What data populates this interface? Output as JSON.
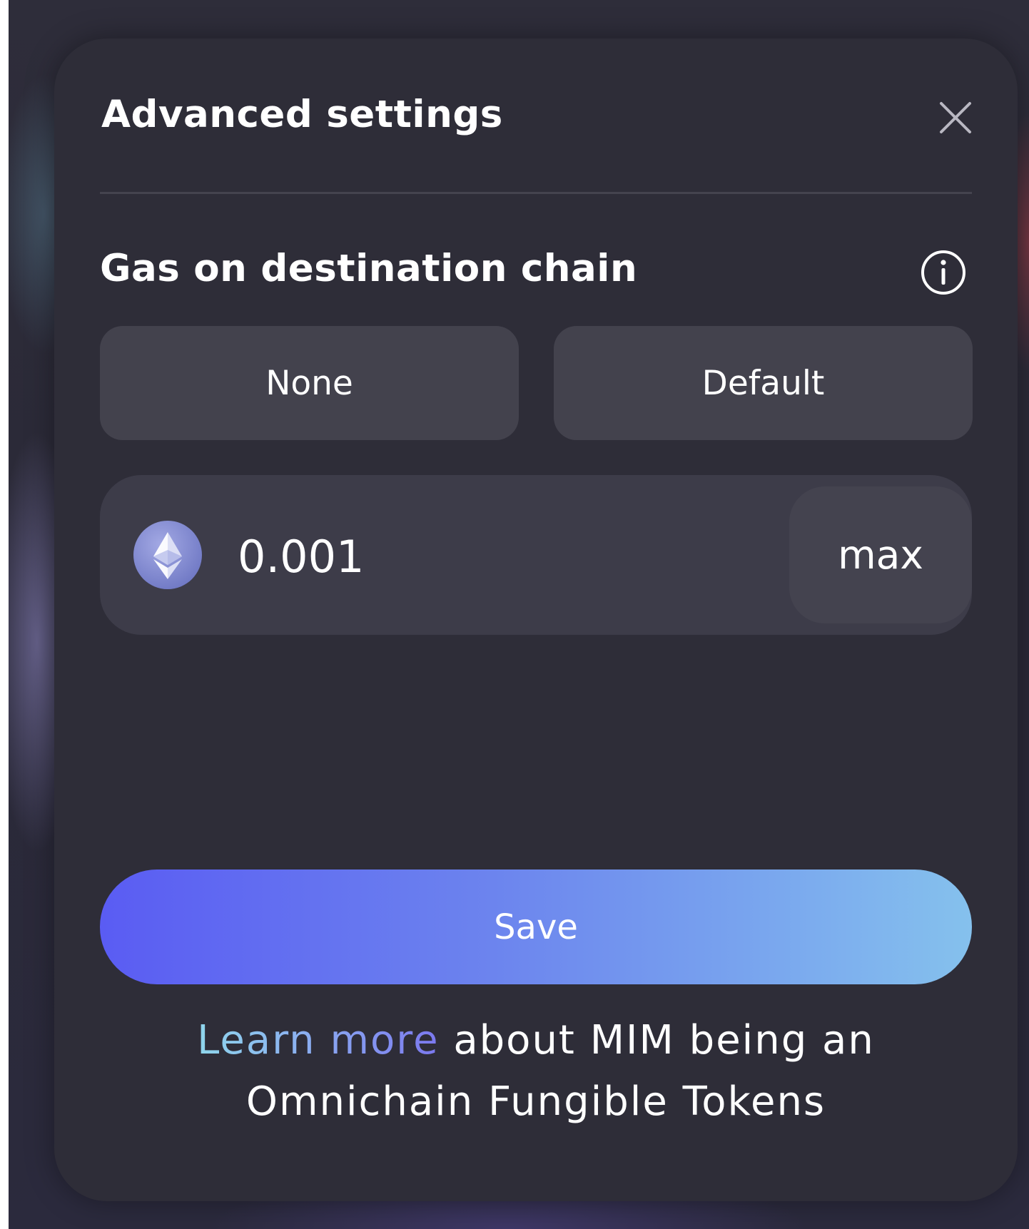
{
  "modal": {
    "title": "Advanced settings",
    "close_icon": "close-icon"
  },
  "gas": {
    "section_title": "Gas on destination chain",
    "info_icon": "info-icon",
    "options": {
      "none_label": "None",
      "default_label": "Default"
    },
    "amount": {
      "token_icon": "ethereum-icon",
      "value": "0.001",
      "max_label": "max"
    }
  },
  "actions": {
    "save_label": "Save"
  },
  "footnote": {
    "link_text": "Learn more",
    "line1_rest": " about MIM being an",
    "line2": "Omnichain Fungible Tokens"
  },
  "colors": {
    "modal_background": "#2e2d38",
    "option_button": "#43424d",
    "amount_box": "#3d3c49",
    "save_gradient_start": "#5a5cf3",
    "save_gradient_end": "#85c1ed",
    "link_gradient_start": "#8fd6ec",
    "link_gradient_end": "#7b78ef"
  }
}
